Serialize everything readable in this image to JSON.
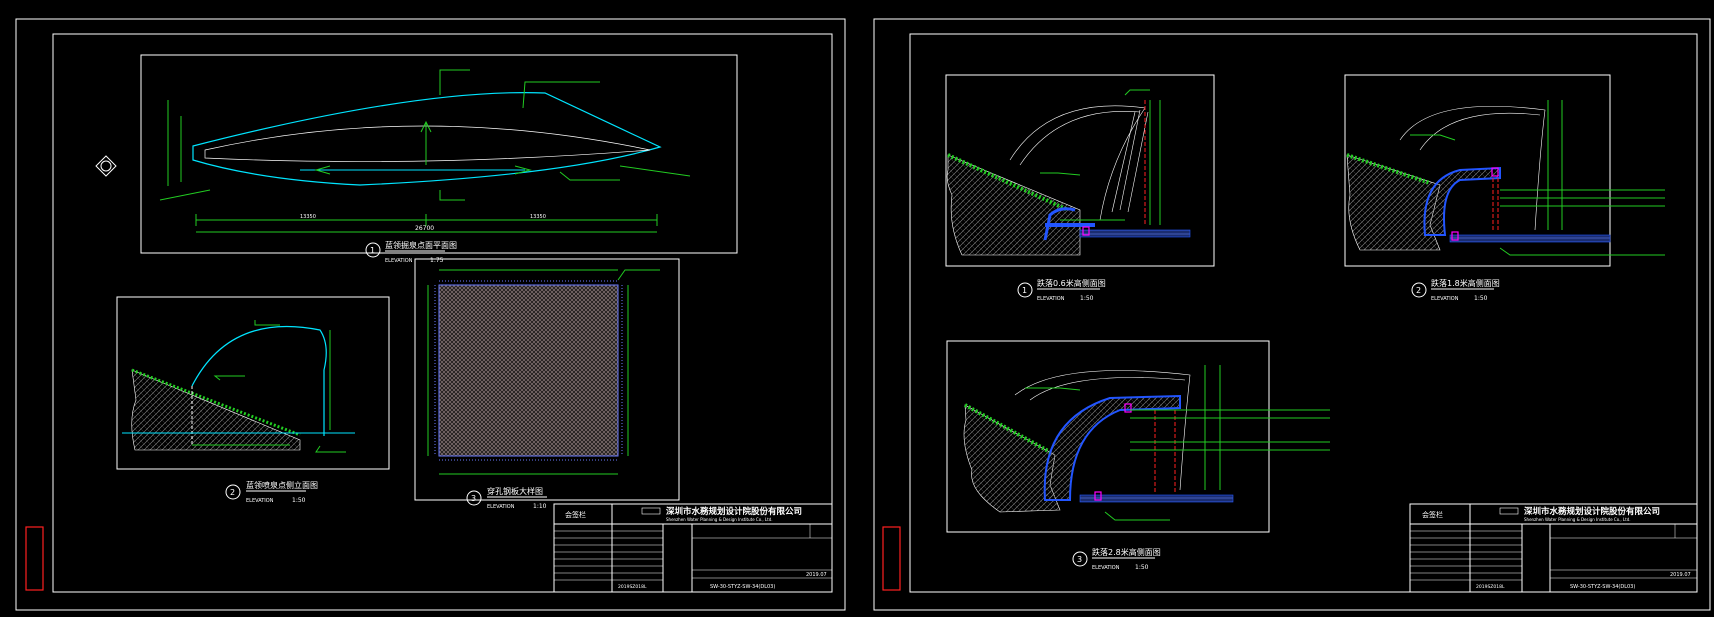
{
  "sheet_left": {
    "views": [
      {
        "num": "1",
        "title": "蓝领掘泉点面平面图",
        "elev": "ELEVATION",
        "scale": "1:75"
      },
      {
        "num": "2",
        "title": "蓝领喷泉点侧立面图",
        "elev": "ELEVATION",
        "scale": "1:50"
      },
      {
        "num": "3",
        "title": "穿孔钢板大样图",
        "elev": "ELEVATION",
        "scale": "1:10"
      }
    ],
    "dims": {
      "overall": "26700",
      "left_half": "13350",
      "right_half": "13350"
    },
    "titleblock": {
      "header_left": "会签栏",
      "company_cn": "深圳市水務规划设计院股份有限公司",
      "company_en": "Shenzhen Water Planning & Design Institute Co., Ltd.",
      "drawing_no": "SW-30-STYZ-SW-34(DL03)",
      "date": "2019.07",
      "code": "2019SZ018L"
    }
  },
  "sheet_right": {
    "views": [
      {
        "num": "1",
        "title": "跌落0.6米高侧面图",
        "elev": "ELEVATION",
        "scale": "1:50"
      },
      {
        "num": "2",
        "title": "跌落1.8米高侧面图",
        "elev": "ELEVATION",
        "scale": "1:50"
      },
      {
        "num": "3",
        "title": "跌落2.8米高侧面图",
        "elev": "ELEVATION",
        "scale": "1:50"
      }
    ],
    "titleblock": {
      "header_left": "会签栏",
      "company_cn": "深圳市水務规划设计院股份有限公司",
      "company_en": "Shenzhen Water Planning & Design Institute Co., Ltd.",
      "drawing_no": "SW-30-STYZ-SW-34(DL03)",
      "date": "2019.07",
      "code": "2019SZ018L"
    }
  },
  "colors": {
    "background": "#000000",
    "line": "#ffffff",
    "cyan": "#00e5ff",
    "green": "#22cc22",
    "red": "#ff2020",
    "blue": "#2255ff",
    "magenta": "#ff00ff"
  }
}
